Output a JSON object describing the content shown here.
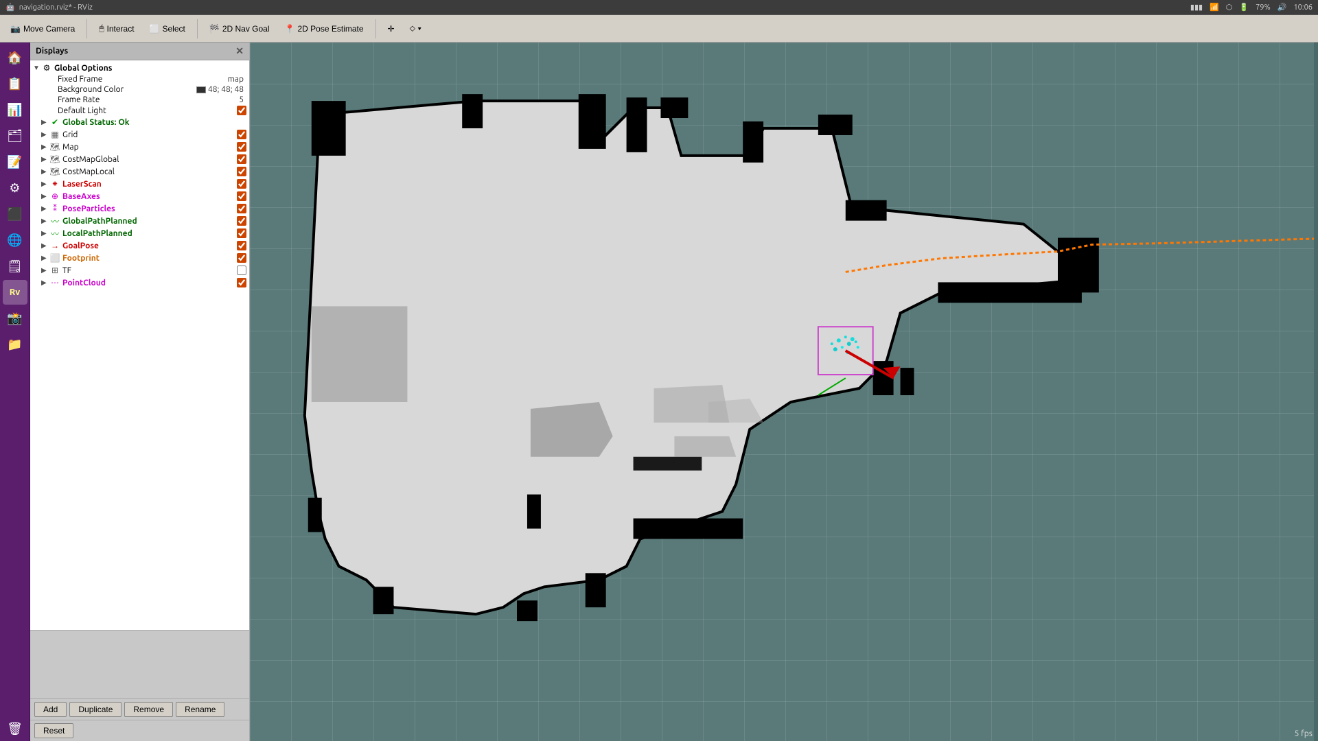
{
  "titlebar": {
    "title": "navigation.rviz* - RViz",
    "battery": "79%",
    "time": "10:06",
    "network_icon": "📶",
    "bluetooth_icon": "🔵",
    "volume_icon": "🔊"
  },
  "toolbar": {
    "move_camera": "Move Camera",
    "interact": "Interact",
    "select": "Select",
    "nav_goal": "2D Nav Goal",
    "pose_estimate": "2D Pose Estimate"
  },
  "displays": {
    "header": "Displays",
    "global_options": {
      "label": "Global Options",
      "fixed_frame_label": "Fixed Frame",
      "fixed_frame_value": "map",
      "bg_color_label": "Background Color",
      "bg_color_value": "48; 48; 48",
      "frame_rate_label": "Frame Rate",
      "frame_rate_value": "5",
      "default_light_label": "Default Light"
    },
    "items": [
      {
        "label": "Global Status: Ok",
        "color": "green",
        "indent": 1,
        "has_arrow": true,
        "has_checkbox": false
      },
      {
        "label": "Grid",
        "color": "default",
        "indent": 1,
        "has_arrow": true,
        "has_checkbox": true,
        "checked": true
      },
      {
        "label": "Map",
        "color": "default",
        "indent": 1,
        "has_arrow": true,
        "has_checkbox": true,
        "checked": true
      },
      {
        "label": "CostMapGlobal",
        "color": "default",
        "indent": 1,
        "has_arrow": true,
        "has_checkbox": true,
        "checked": true
      },
      {
        "label": "CostMapLocal",
        "color": "default",
        "indent": 1,
        "has_arrow": true,
        "has_checkbox": true,
        "checked": true
      },
      {
        "label": "LaserScan",
        "color": "red",
        "indent": 1,
        "has_arrow": true,
        "has_checkbox": true,
        "checked": true
      },
      {
        "label": "BaseAxes",
        "color": "magenta",
        "indent": 1,
        "has_arrow": true,
        "has_checkbox": true,
        "checked": true
      },
      {
        "label": "PoseParticles",
        "color": "cyan",
        "indent": 1,
        "has_arrow": true,
        "has_checkbox": true,
        "checked": true
      },
      {
        "label": "GlobalPathPlanned",
        "color": "green",
        "indent": 1,
        "has_arrow": true,
        "has_checkbox": true,
        "checked": true
      },
      {
        "label": "LocalPathPlanned",
        "color": "green",
        "indent": 1,
        "has_arrow": true,
        "has_checkbox": true,
        "checked": true
      },
      {
        "label": "GoalPose",
        "color": "red",
        "indent": 1,
        "has_arrow": true,
        "has_checkbox": true,
        "checked": true
      },
      {
        "label": "Footprint",
        "color": "orange",
        "indent": 1,
        "has_arrow": true,
        "has_checkbox": true,
        "checked": true
      },
      {
        "label": "TF",
        "color": "default",
        "indent": 1,
        "has_arrow": true,
        "has_checkbox": true,
        "checked": false
      },
      {
        "label": "PointCloud",
        "color": "magenta",
        "indent": 1,
        "has_arrow": true,
        "has_checkbox": true,
        "checked": true
      }
    ]
  },
  "buttons": {
    "add": "Add",
    "duplicate": "Duplicate",
    "remove": "Remove",
    "rename": "Rename",
    "reset": "Reset"
  },
  "viewport": {
    "fps": "5 fps"
  }
}
